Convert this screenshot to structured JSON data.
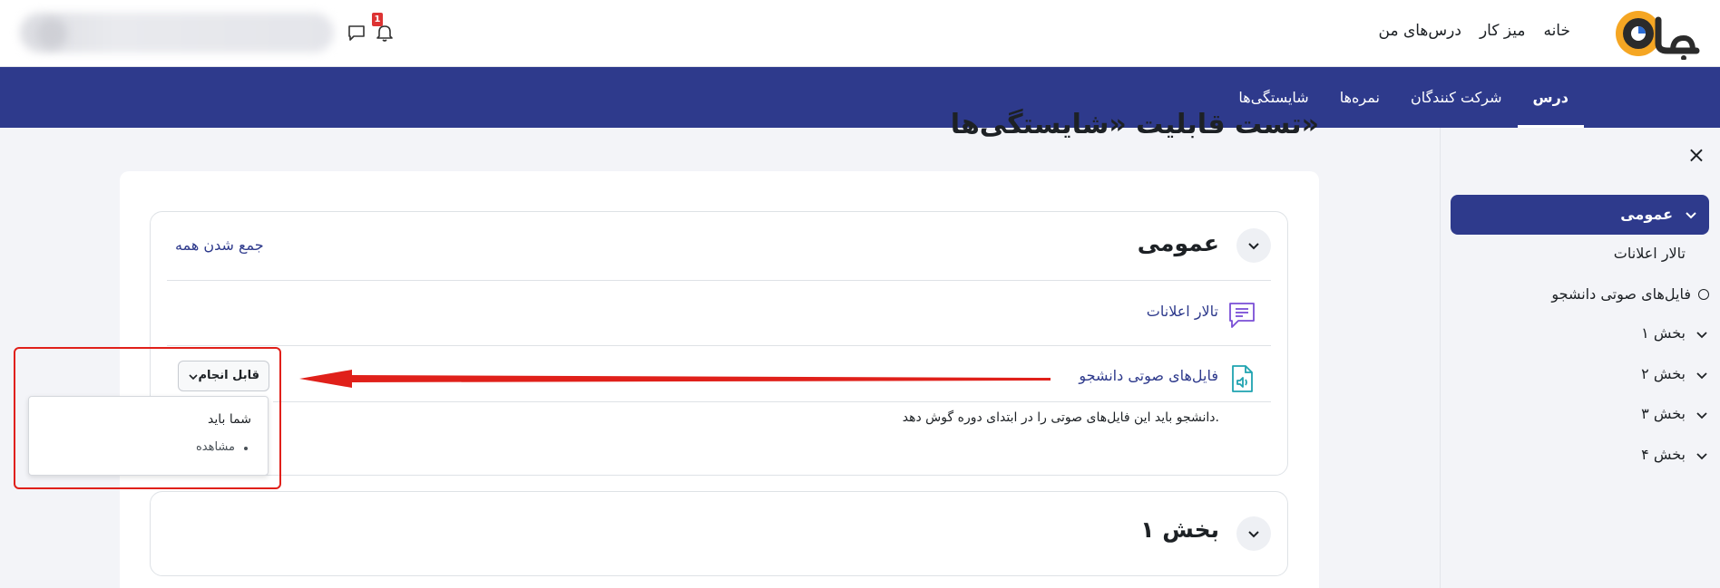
{
  "header": {
    "nav": [
      {
        "label": "خانه"
      },
      {
        "label": "میز کار"
      },
      {
        "label": "درس‌های من"
      }
    ],
    "notification_count": "1",
    "icons": [
      "logo-icon",
      "bell-icon",
      "chat-icon",
      "user-avatar"
    ]
  },
  "course_nav": {
    "tabs": [
      {
        "label": "درس",
        "active": true
      },
      {
        "label": "شرکت کنندگان"
      },
      {
        "label": "نمره‌ها"
      },
      {
        "label": "شایستگی‌ها"
      }
    ]
  },
  "drawer": {
    "close": "×",
    "items": [
      {
        "label": "عمومی",
        "active": true
      },
      {
        "label": "تالار اعلانات"
      },
      {
        "label": "فایل‌های صوتی دانشجو"
      },
      {
        "label": "بخش ۱"
      },
      {
        "label": "بخش ۲"
      },
      {
        "label": "بخش ۳"
      },
      {
        "label": "بخش ۴"
      }
    ]
  },
  "page": {
    "title": "تست قابلیت «شایستگی‌ها»"
  },
  "general_section": {
    "title": "عمومی",
    "collapse_all": "جمع شدن همه",
    "activities": [
      {
        "name": "تالار اعلانات",
        "icon": "forum-icon"
      },
      {
        "name": "فایل‌های صوتی دانشجو",
        "icon": "audio-file-icon"
      }
    ],
    "description": "دانشجو باید این فایل‌های صوتی را در ابتدای دوره گوش دهد.",
    "completion": {
      "button": "قابل انجام",
      "heading": "شما باید",
      "requirement": "مشاهده"
    }
  },
  "section_one": {
    "title": "بخش ۱"
  },
  "colors": {
    "primary": "#2e3a8c",
    "annotation": "#e0201a",
    "forum_icon": "#7a4fd6",
    "audio_icon": "#1fa3b0"
  }
}
